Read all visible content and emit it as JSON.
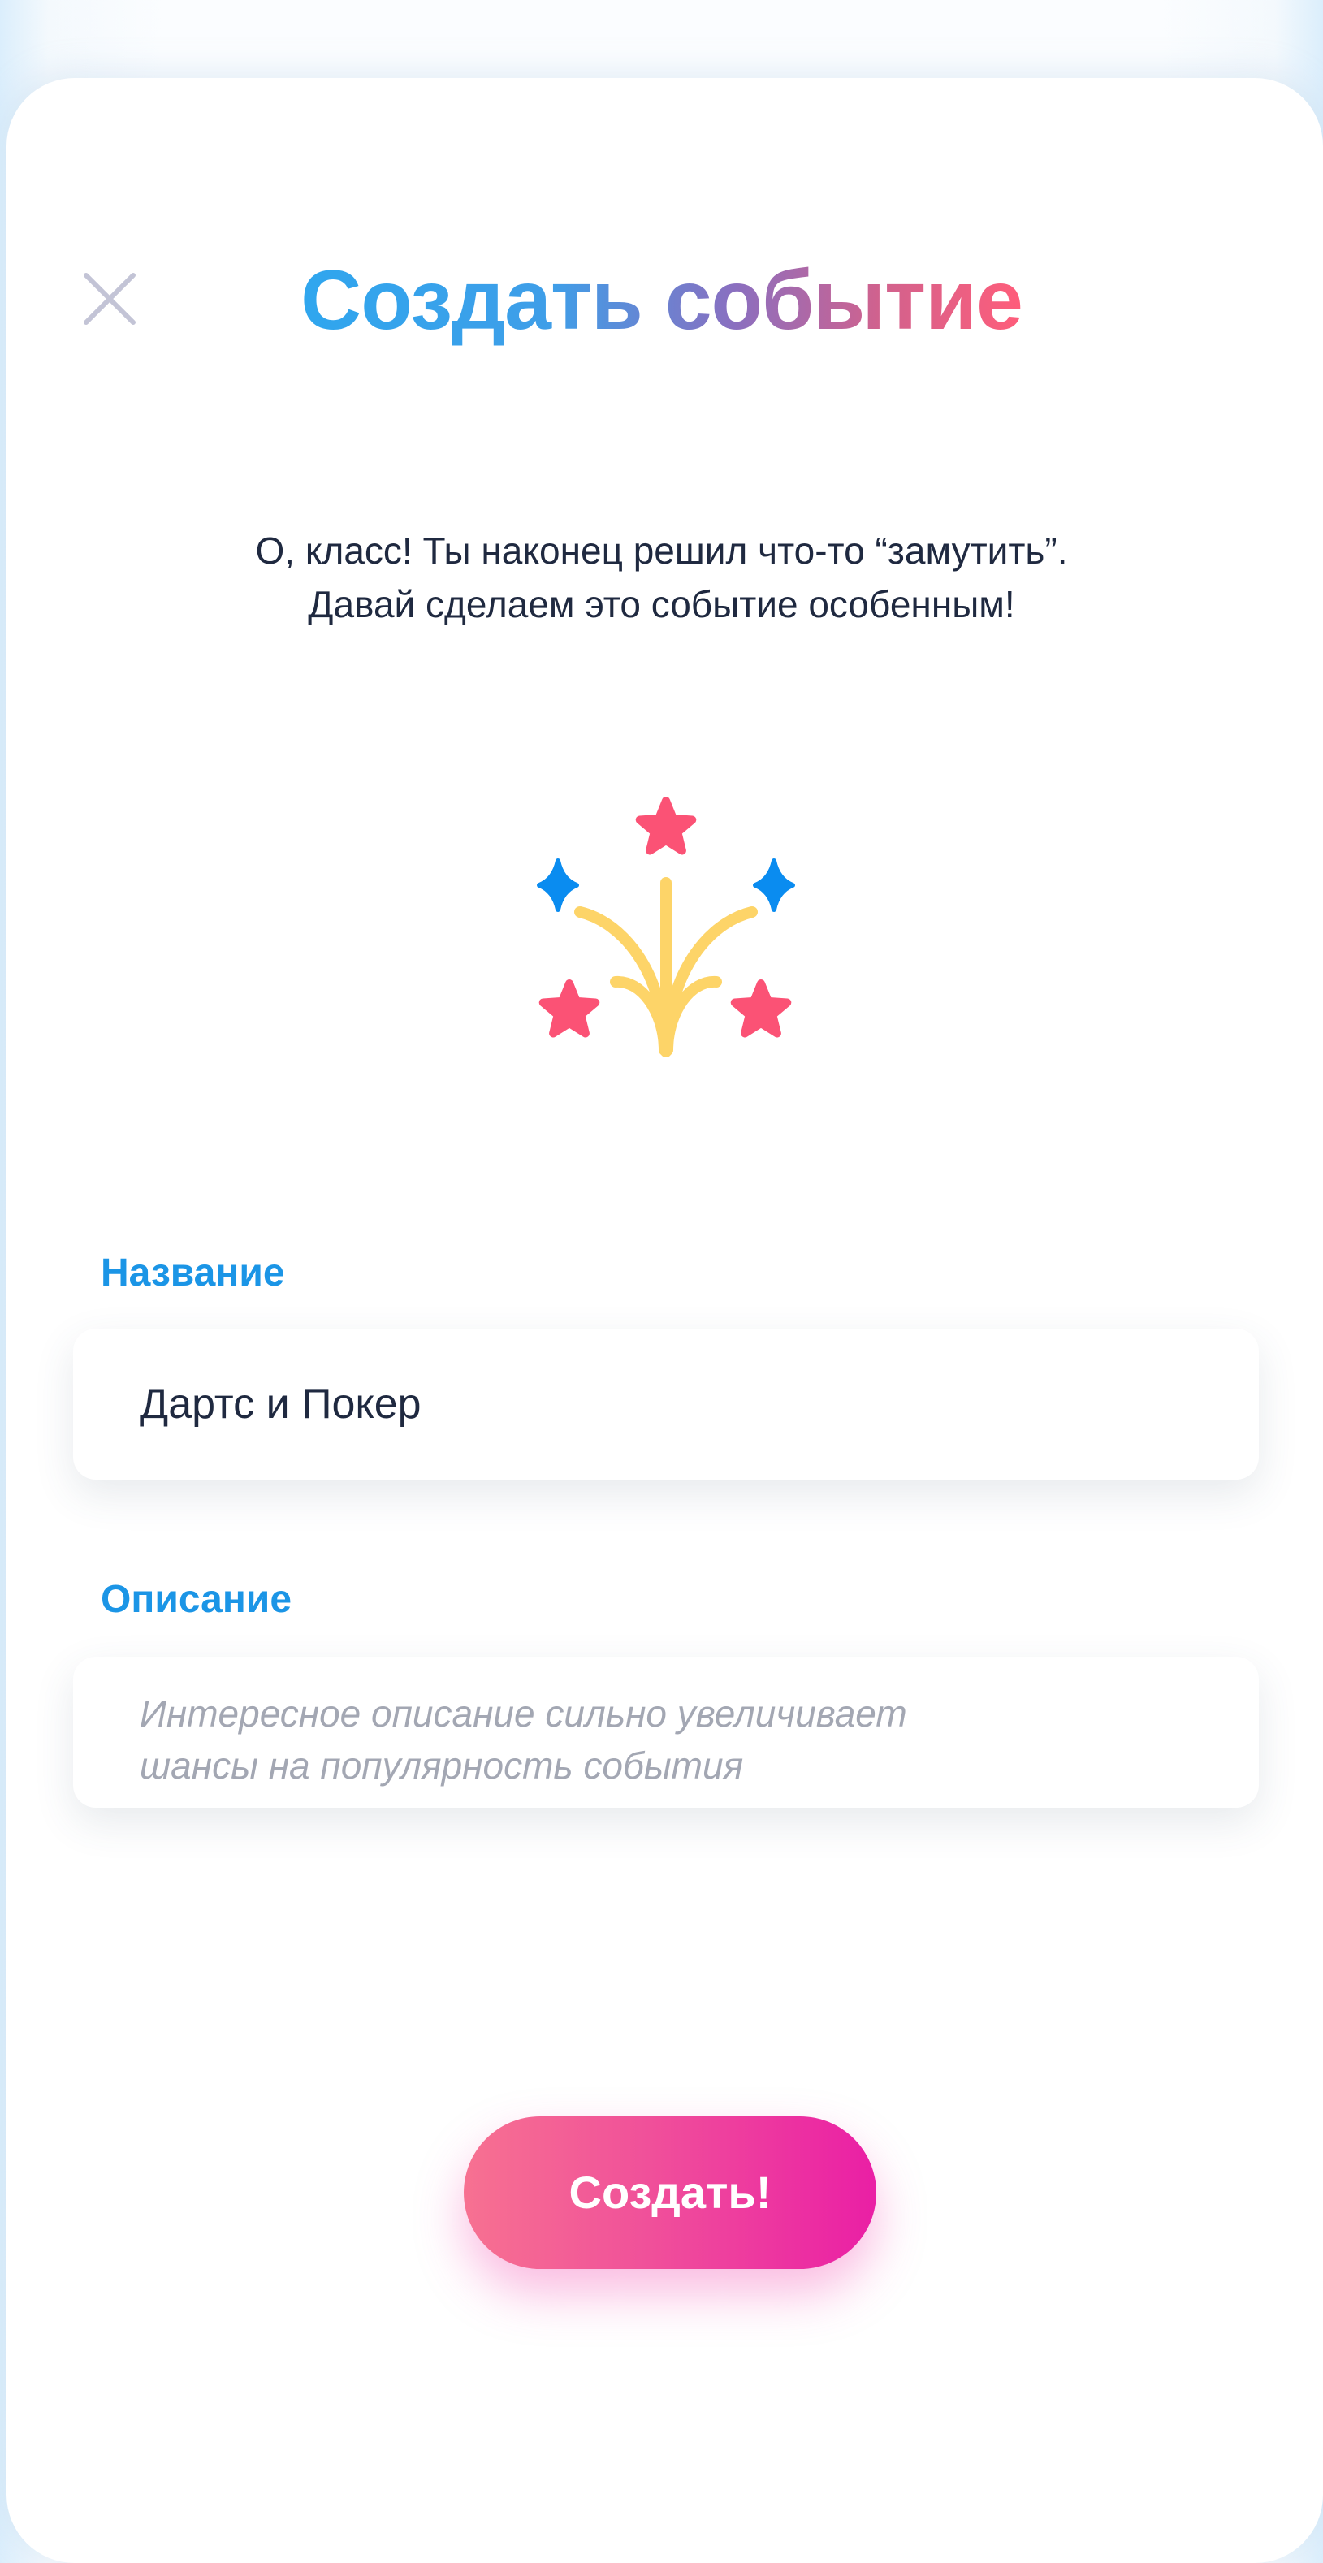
{
  "dialog": {
    "title": "Создать событие",
    "intro_line1": "О, класс!  Ты наконец решил что-то “замутить”.",
    "intro_line2": "Давай сделаем это событие особенным!",
    "close_icon": "close-icon",
    "illustration_icon": "fireworks-icon"
  },
  "form": {
    "name_label": "Название",
    "name_value": "Дартс и Покер",
    "description_label": "Описание",
    "description_placeholder": "Интересное описание сильно увеличивает шансы на популярность события",
    "description_value": ""
  },
  "actions": {
    "create_label": "Создать!"
  },
  "colors": {
    "accent_blue": "#1b95e6",
    "title_gradient": [
      "#2fa6ee",
      "#ff5d7a"
    ],
    "button_gradient": [
      "#f77191",
      "#ea1fa5"
    ],
    "text_dark": "#1f2940",
    "placeholder": "#a3a7b3",
    "star_pink": "#fb5275",
    "star_blue": "#0a8cf0",
    "rays_yellow": "#fdd468"
  }
}
